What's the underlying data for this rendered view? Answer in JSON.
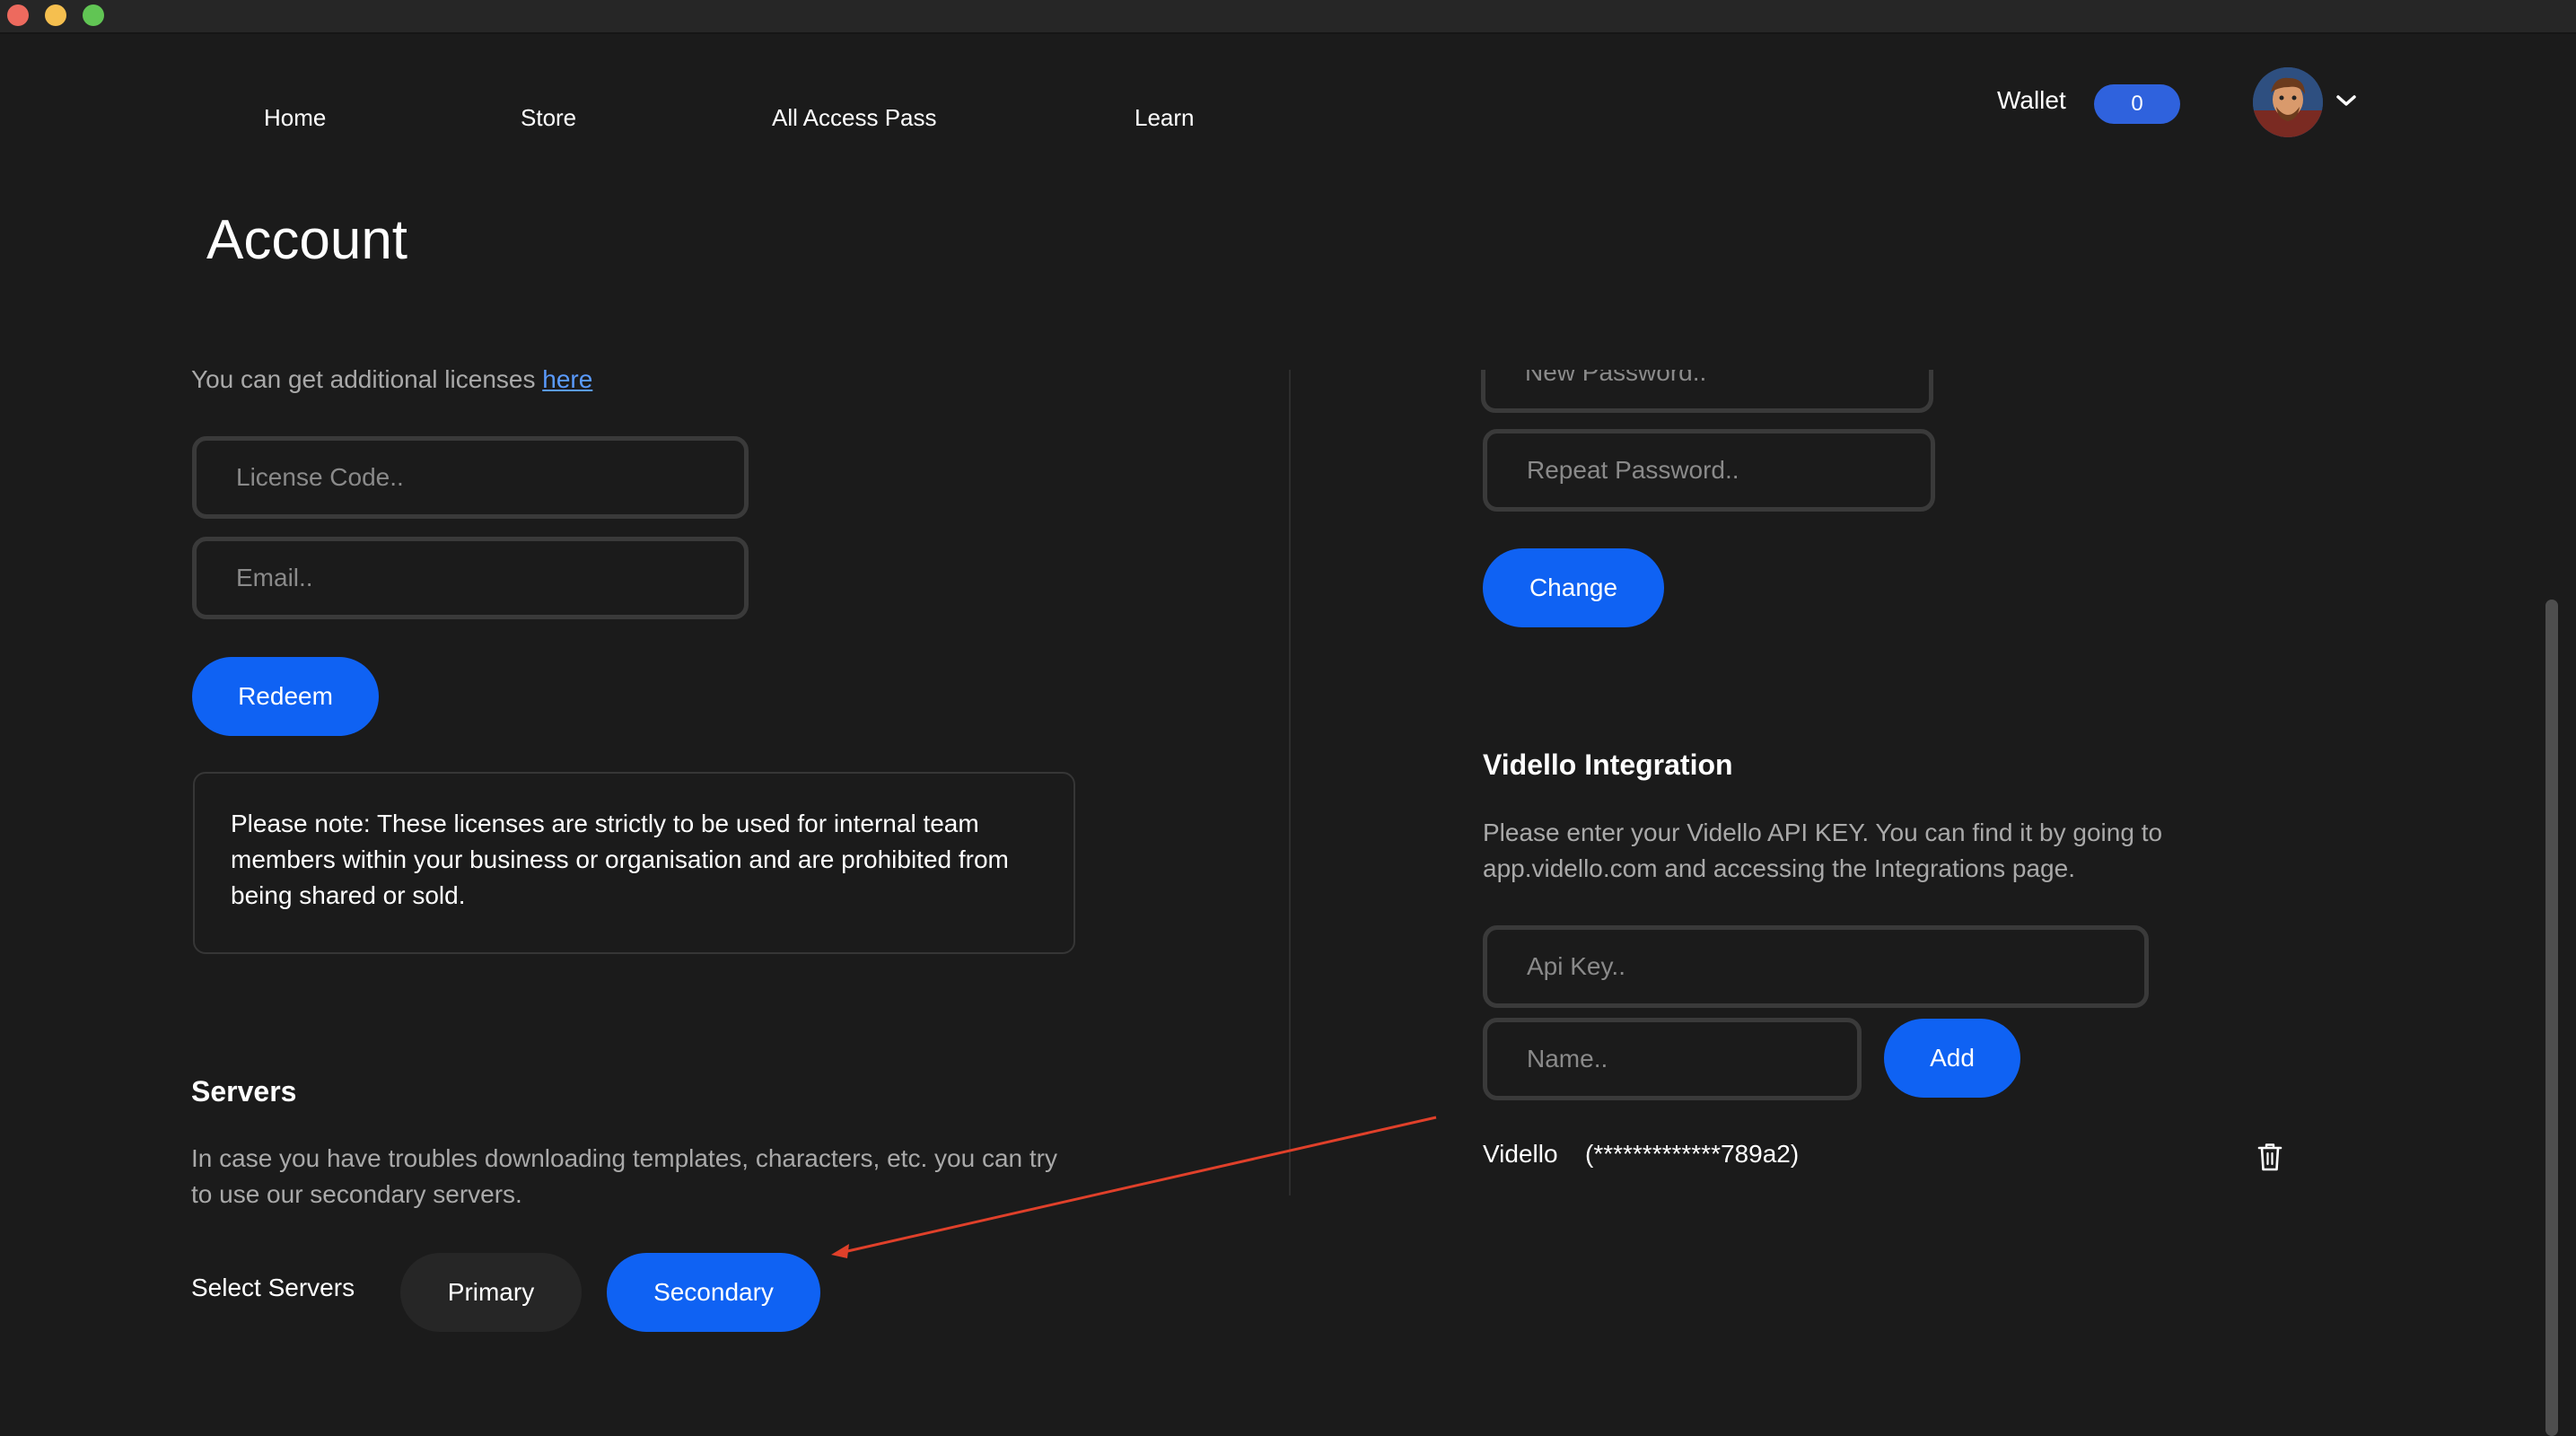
{
  "nav": {
    "items": [
      {
        "label": "Home"
      },
      {
        "label": "Store"
      },
      {
        "label": "All Access Pass"
      },
      {
        "label": "Learn"
      }
    ]
  },
  "wallet": {
    "label": "Wallet",
    "count": "0"
  },
  "page": {
    "title": "Account"
  },
  "licenses": {
    "intro": "You can get additional licenses ",
    "link_text": "here",
    "license_placeholder": "License Code..",
    "email_placeholder": "Email..",
    "redeem_label": "Redeem",
    "note": "Please note: These licenses are strictly to be used for internal team members within your business or organisation and are prohibited from being shared or sold."
  },
  "servers": {
    "title": "Servers",
    "description": "In case you have troubles downloading templates, characters, etc. you can try to use our secondary servers.",
    "select_label": "Select Servers",
    "primary_label": "Primary",
    "secondary_label": "Secondary",
    "selected": "Secondary"
  },
  "password": {
    "new_placeholder": "New Password..",
    "repeat_placeholder": "Repeat Password..",
    "change_label": "Change"
  },
  "vidello": {
    "title": "Vidello Integration",
    "description": "Please enter your Vidello API KEY. You can find it by going to app.vidello.com and accessing the Integrations page.",
    "api_key_placeholder": "Api Key..",
    "name_placeholder": "Name..",
    "add_label": "Add",
    "integrations": [
      {
        "name": "Vidello",
        "key_masked": "(*************789a2)"
      }
    ]
  },
  "icons": {
    "delete": "trash-icon",
    "dropdown": "chevron-down-icon",
    "avatar": "user-avatar"
  },
  "colors": {
    "background": "#1b1b1b",
    "primary_button": "#0f62f3",
    "wallet_badge": "#2f62dd",
    "annotation_arrow": "#e0402a"
  }
}
